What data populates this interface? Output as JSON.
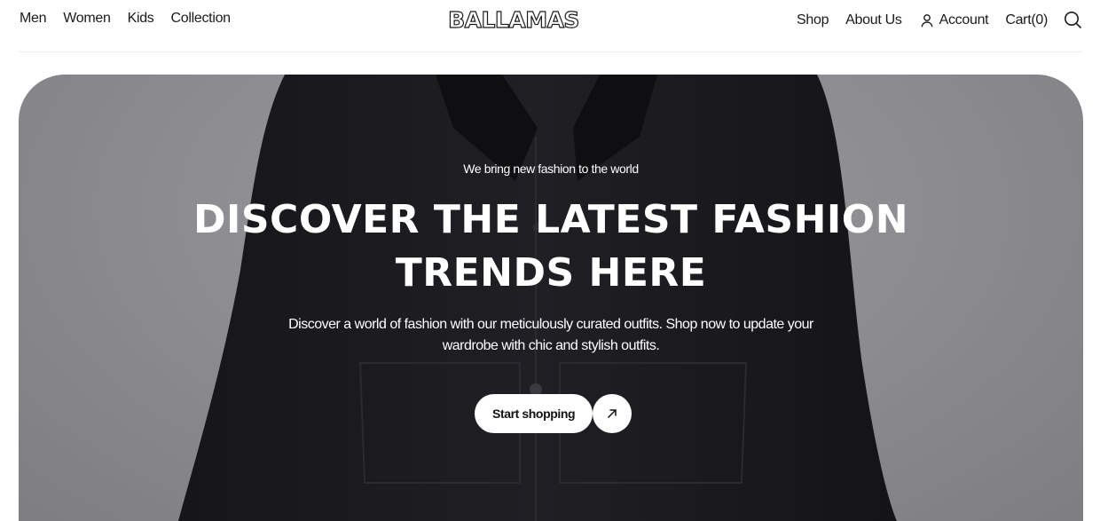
{
  "header": {
    "nav_left": [
      "Men",
      "Women",
      "Kids",
      "Collection"
    ],
    "logo_text": "BALLAMAS",
    "nav_right": {
      "shop": "Shop",
      "about": "About Us",
      "account": "Account",
      "cart": "Cart(0)"
    },
    "icons": {
      "account": "user-icon",
      "search": "search-icon"
    }
  },
  "hero": {
    "tagline": "We bring new fashion to the world",
    "title": "DISCOVER THE LATEST FASHION TRENDS HERE",
    "description": "Discover a world of fashion with our meticulously curated outfits. Shop now to update your wardrobe with chic and stylish outfits.",
    "cta_label": "Start shopping",
    "cta_icon": "arrow-up-right-icon"
  },
  "colors": {
    "text": "#1a1a1a",
    "hero_overlay_text": "#ffffff",
    "button_bg": "#ffffff"
  }
}
